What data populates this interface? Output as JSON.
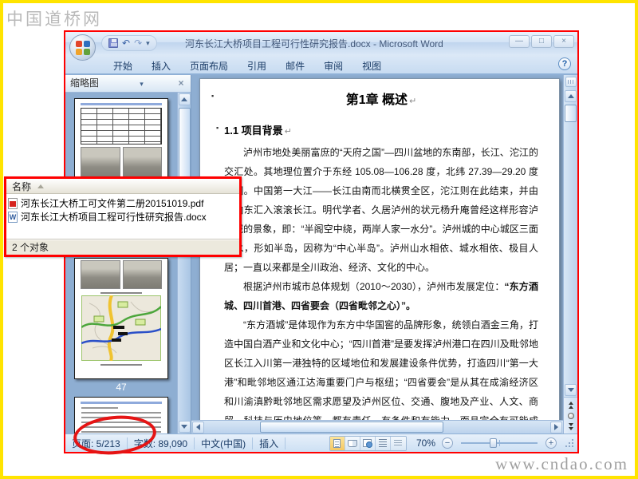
{
  "frame": {
    "border_color": "#FFE400"
  },
  "watermarks": {
    "top_left": "中国道桥网",
    "bottom_right": "www.cndao.com"
  },
  "window": {
    "title": "河东长江大桥项目工程可行性研究报告.docx - Microsoft Word",
    "border_color": "#FF0000",
    "controls": {
      "minimize": "—",
      "maximize": "□",
      "close": "×"
    }
  },
  "quick_access": {
    "undo": "↶",
    "redo": "↷",
    "dropdown": "▾"
  },
  "ribbon": {
    "tabs": [
      "开始",
      "插入",
      "页面布局",
      "引用",
      "邮件",
      "审阅",
      "视图"
    ],
    "help": "?"
  },
  "thumbnail_pane": {
    "title": "缩略图",
    "dropdown": "▾",
    "close": "×",
    "page_number_label": "47"
  },
  "document": {
    "chapter_heading": "第1章 概述",
    "section_heading": "1.1 项目背景",
    "paragraph_mark": "↵",
    "bullet": "▪",
    "paragraphs": [
      {
        "segments": [
          {
            "text": "泸州市地处美丽富庶的“天府之国”—四川盆地的东南部，长江、沱江的交汇处。其地理位置介于东经 105.08—106.28 度，北纬 27.39—29.20 度之间。中国第一大江——长江由南而北横贯全区，沱江则在此结束，并由西向东汇入滚滚长江。明代学者、久居泸州的状元杨升庵曾经这样形容泸州城的景象，即：“半阁空中绕，两岸人家一水分”。泸州城的中心城区三面临水，形如半岛，因称为“中心半岛”。泸州山水相依、城水相依、极目人居；一直以来都是全川政治、经济、文化的中心。",
            "bold": false
          }
        ]
      },
      {
        "segments": [
          {
            "text": "根据泸州市城市总体规划（2010～2030），泸州市发展定位：",
            "bold": false
          },
          {
            "text": "“东方酒城、四川首港、四省要会（四省毗邻之心）”。",
            "bold": true
          }
        ]
      },
      {
        "segments": [
          {
            "text": "“东方酒城”是体现作为东方中华国窖的品牌形象，统领白酒金三角，打造中国白酒产业和文化中心；“四川首港”是要发挥泸州港口在四川及毗邻地区长江入川第一港独特的区域地位和发展建设条件优势，打造四川“第一大港”和毗邻地区通江达海重要门户与枢纽；“四省要会”是从其在成渝经济区和川渝滇黔毗邻地区需求愿望及泸州区位、交通、腹地及产业、人文、商贸、科技与历史地位等，都有责任、有条件和有能力，而且完全有可能成为整合四省毗邻地区，提升川南，从而形成四省区域联通、区域服务、产业聚集的区域性枢纽城市和中心",
            "bold": false
          }
        ]
      }
    ]
  },
  "file_popup": {
    "column_header": "名称",
    "files": [
      {
        "icon": "pdf-file-icon",
        "type": "pdf",
        "name": "河东长江大桥工可文件第二册20151019.pdf"
      },
      {
        "icon": "word-file-icon",
        "type": "doc",
        "name": "河东长江大桥项目工程可行性研究报告.docx"
      }
    ],
    "status": "2 个对象"
  },
  "statusbar": {
    "page": "页面: 5/213",
    "word_count": "字数: 89,090",
    "language": "中文(中国)",
    "mode": "插入",
    "zoom_level": "70%"
  },
  "annotation": {
    "circle_color": "#E51414"
  }
}
